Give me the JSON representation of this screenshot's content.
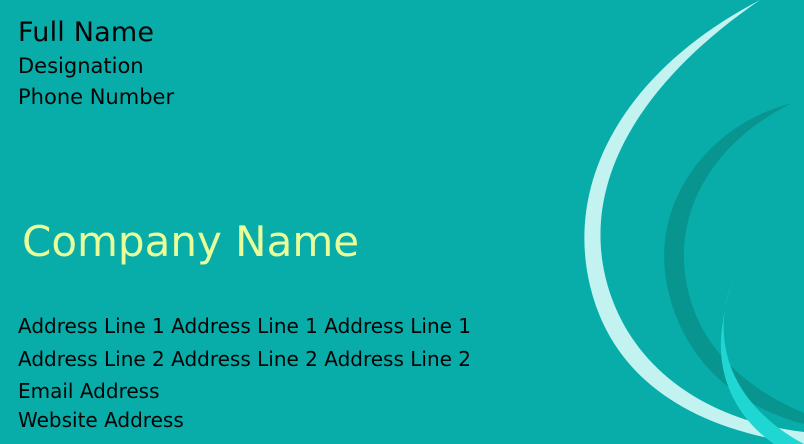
{
  "card": {
    "full_name": "Full Name",
    "designation": "Designation",
    "phone": "Phone Number",
    "company_name": "Company Name",
    "address_line_1": "Address Line 1 Address Line 1 Address Line 1",
    "address_line_2": "Address Line 2 Address Line 2 Address Line 2",
    "email": "Email Address",
    "website": "Website Address"
  },
  "colors": {
    "background": "#08aca8",
    "text": "#050505",
    "accent": "#e9ff9a",
    "light_swoosh": "#c2f3f1",
    "dark_swoosh": "#08958f",
    "bright_swoosh": "#20d6d2"
  }
}
